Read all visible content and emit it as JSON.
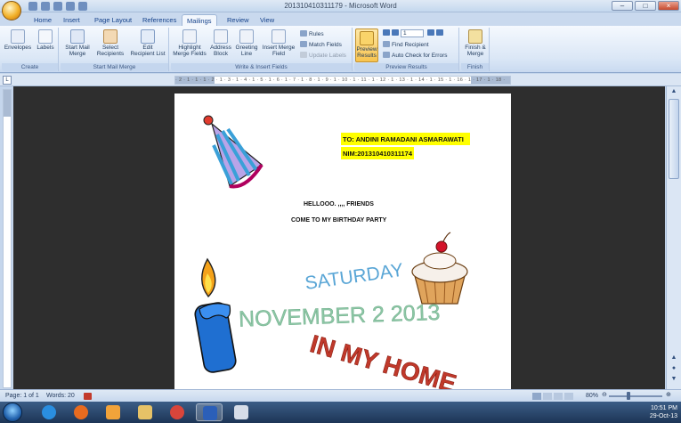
{
  "window": {
    "title": "201310410311179 - Microsoft Word"
  },
  "tabs": [
    "Home",
    "Insert",
    "Page Layout",
    "References",
    "Mailings",
    "Review",
    "View"
  ],
  "active_tab": "Mailings",
  "ribbon": {
    "create": {
      "label": "Create",
      "envelopes": "Envelopes",
      "labels": "Labels"
    },
    "start": {
      "label": "Start Mail Merge",
      "start_line1": "Start Mail",
      "start_line2": "Merge",
      "select_line1": "Select",
      "select_line2": "Recipients",
      "edit_line1": "Edit",
      "edit_line2": "Recipient List"
    },
    "write": {
      "label": "Write & Insert Fields",
      "highlight_line1": "Highlight",
      "highlight_line2": "Merge Fields",
      "address_line1": "Address",
      "address_line2": "Block",
      "greeting_line1": "Greeting",
      "greeting_line2": "Line",
      "insert_line1": "Insert Merge",
      "insert_line2": "Field",
      "rules": "Rules",
      "match": "Match Fields",
      "update": "Update Labels"
    },
    "preview": {
      "label": "Preview Results",
      "btn_line1": "Preview",
      "btn_line2": "Results",
      "record_value": "1",
      "find": "Find Recipient",
      "auto": "Auto Check for Errors"
    },
    "finish": {
      "label": "Finish",
      "btn_line1": "Finish &",
      "btn_line2": "Merge"
    }
  },
  "ruler": {
    "text": "· 2 · 1 · 1 · 1 · 2 · 1 · 3 · 1 · 4 · 1 · 5 · 1 · 6 · 1 · 7 · 1 · 8 · 1 · 9 · 1 · 10 · 1 · 11 · 1 · 12 · 1 · 13 · 1 · 14 · 1 · 15 · 1 · 16 · 1 · 17 · 1 · 18 ·"
  },
  "document": {
    "to_line": "TO: ANDINI RAMADANI ASMARAWATI",
    "nim_line": "NIM:201310410311174",
    "hello_line": "HELLOOO. ,,,, FRIENDS",
    "come_line": "COME TO MY BIRTHDAY PARTY",
    "saturday": "SATURDAY",
    "date": "NOVEMBER 2 2013",
    "place": "IN MY HOME"
  },
  "status": {
    "page": "Page: 1 of 1",
    "words": "Words: 20",
    "zoom": "80%"
  },
  "taskbar": {
    "time": "10:51 PM",
    "date": "29-Oct-13"
  },
  "colors": {
    "highlight": "#ffff00",
    "saturday": "#5aa6d6",
    "date": "#8cc6a5",
    "place": "#c0392b"
  }
}
